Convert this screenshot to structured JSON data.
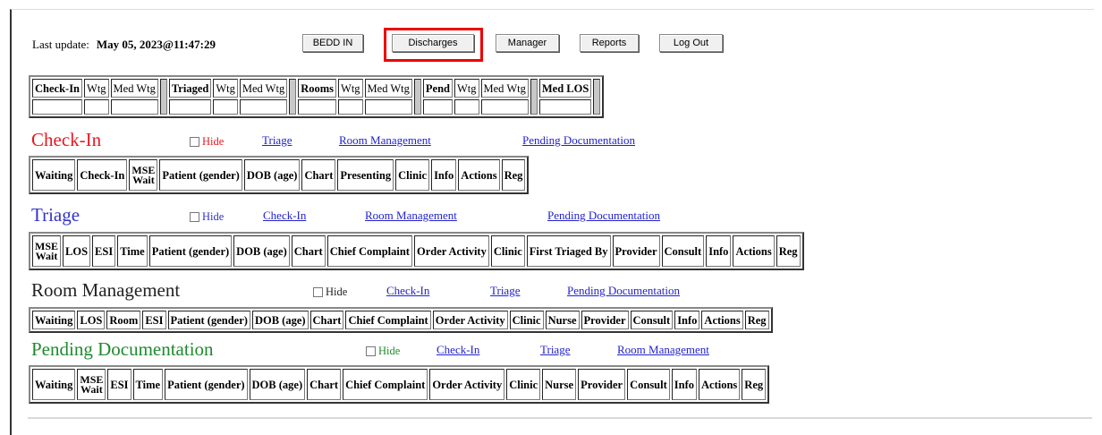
{
  "colors": {
    "checkin_title": "#e8181f",
    "triage_title": "#3333cc",
    "room_title": "#222222",
    "pending_title": "#1f8a2e",
    "link": "#2222cc",
    "highlight": "#ee0000"
  },
  "topbar": {
    "last_update_label": "Last update:",
    "last_update_value": "May 05, 2023@11:47:29",
    "buttons": {
      "bedd_in": "BEDD IN",
      "discharges": "Discharges",
      "manager": "Manager",
      "reports": "Reports",
      "log_out": "Log Out"
    }
  },
  "summary": {
    "headers": [
      "Check-In",
      "Wtg",
      "Med Wtg",
      "Triaged",
      "Wtg",
      "Med Wtg",
      "Rooms",
      "Wtg",
      "Med Wtg",
      "Pend",
      "Wtg",
      "Med Wtg",
      "Med LOS"
    ]
  },
  "sections": {
    "checkin": {
      "title": "Check-In",
      "hide": "Hide",
      "links": [
        "Triage",
        "Room Management",
        "Pending Documentation"
      ],
      "columns": [
        "Waiting",
        "Check-In",
        "MSE",
        "Wait",
        "Patient (gender)",
        "DOB (age)",
        "Chart",
        "Presenting",
        "Clinic",
        "Info",
        "Actions",
        "Reg"
      ]
    },
    "triage": {
      "title": "Triage",
      "hide": "Hide",
      "links": [
        "Check-In",
        "Room Management",
        "Pending Documentation"
      ],
      "columns": [
        "MSE",
        "Wait",
        "LOS",
        "ESI",
        "Time",
        "Patient (gender)",
        "DOB (age)",
        "Chart",
        "Chief Complaint",
        "Order Activity",
        "Clinic",
        "First Triaged By",
        "Provider",
        "Consult",
        "Info",
        "Actions",
        "Reg"
      ]
    },
    "room": {
      "title": "Room Management",
      "hide": "Hide",
      "links": [
        "Check-In",
        "Triage",
        "Pending Documentation"
      ],
      "columns": [
        "Waiting",
        "LOS",
        "Room",
        "ESI",
        "Patient (gender)",
        "DOB (age)",
        "Chart",
        "Chief Complaint",
        "Order Activity",
        "Clinic",
        "Nurse",
        "Provider",
        "Consult",
        "Info",
        "Actions",
        "Reg"
      ]
    },
    "pending": {
      "title": "Pending Documentation",
      "hide": "Hide",
      "links": [
        "Check-In",
        "Triage",
        "Room Management"
      ],
      "columns": [
        "Waiting",
        "MSE",
        "Wait",
        "ESI",
        "Time",
        "Patient (gender)",
        "DOB (age)",
        "Chart",
        "Chief Complaint",
        "Order Activity",
        "Clinic",
        "Nurse",
        "Provider",
        "Consult",
        "Info",
        "Actions",
        "Reg"
      ]
    }
  }
}
